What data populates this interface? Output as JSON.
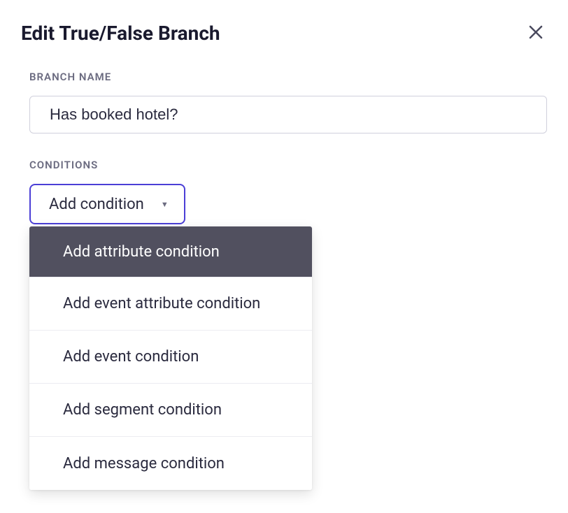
{
  "header": {
    "title": "Edit True/False Branch"
  },
  "branch_name": {
    "label": "BRANCH NAME",
    "value": "Has booked hotel?"
  },
  "conditions": {
    "label": "CONDITIONS",
    "trigger_label": "Add condition",
    "options": [
      {
        "label": "Add attribute condition",
        "highlighted": true
      },
      {
        "label": "Add event attribute condition",
        "highlighted": false
      },
      {
        "label": "Add event condition",
        "highlighted": false
      },
      {
        "label": "Add segment condition",
        "highlighted": false
      },
      {
        "label": "Add message condition",
        "highlighted": false
      }
    ]
  }
}
